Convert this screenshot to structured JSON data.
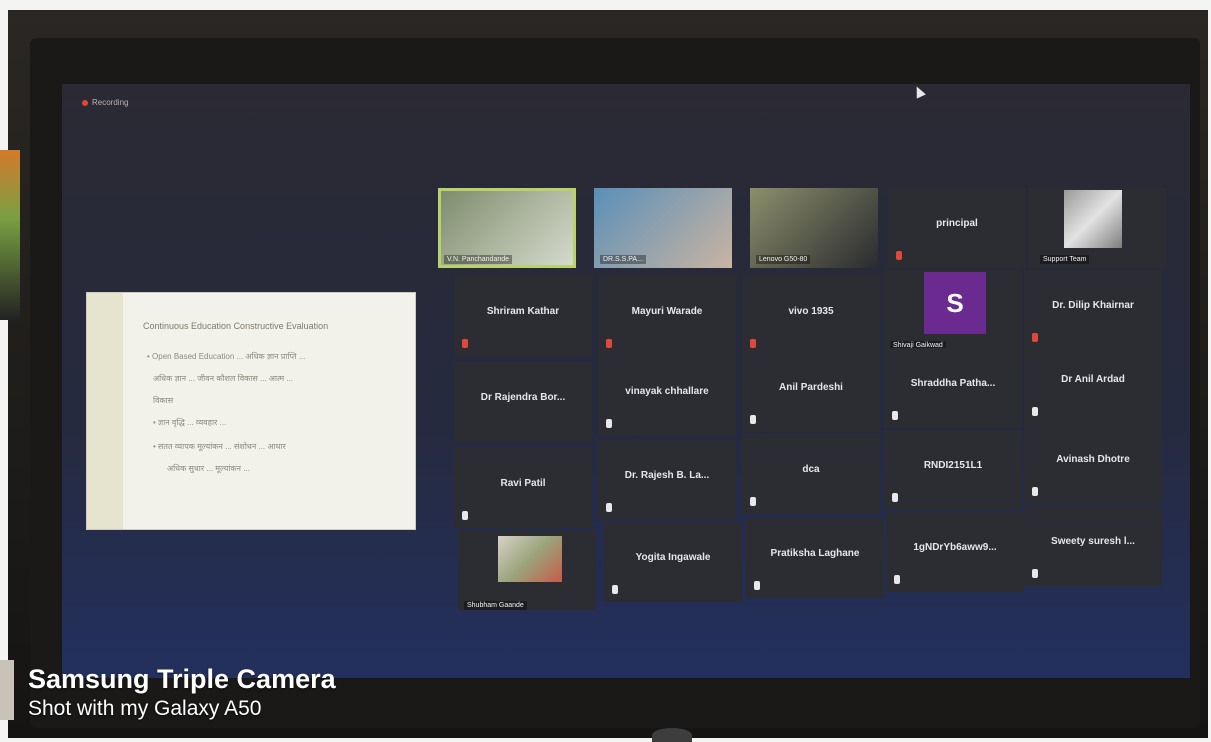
{
  "recording": {
    "label": "Recording"
  },
  "shared_screen": {
    "title": "Continuous Education Constructive Evaluation",
    "lines": [
      "• Open Based Education ... अधिक ज्ञान प्राप्ति ...",
      "अधिक ज्ञान ... जीवन कौशल विकास ... आत्म ...",
      "विकास",
      "• ज्ञान वृद्धि ... व्यवहार ...",
      "• सतत व्यापक मूल्यांकन ... संशोधन ... आधार",
      "अधिक सुधार ... मूल्यांकन ..."
    ]
  },
  "participants": [
    {
      "name": "V.N. Panchandande",
      "type": "video",
      "active": true
    },
    {
      "name": "DR.S.S.PA...",
      "type": "video"
    },
    {
      "name": "Lenovo G50-80",
      "type": "video"
    },
    {
      "name": "principal",
      "type": "text"
    },
    {
      "name": "Support Team",
      "type": "image"
    },
    {
      "name": "Shriram Kathar",
      "type": "text"
    },
    {
      "name": "Mayuri Warade",
      "type": "text"
    },
    {
      "name": "vivo 1935",
      "type": "text"
    },
    {
      "name": "Shivaji Gaikwad",
      "type": "avatar",
      "initial": "S"
    },
    {
      "name": "Dr. Dilip Khairnar",
      "type": "text"
    },
    {
      "name": "Dr Rajendra Bor...",
      "type": "text"
    },
    {
      "name": "vinayak chhallare",
      "type": "text"
    },
    {
      "name": "Anil Pardeshi",
      "type": "text"
    },
    {
      "name": "Shraddha Patha...",
      "type": "text"
    },
    {
      "name": "Dr Anil Ardad",
      "type": "text"
    },
    {
      "name": "Ravi Patil",
      "type": "text"
    },
    {
      "name": "Dr. Rajesh B. La...",
      "type": "text"
    },
    {
      "name": "dca",
      "type": "text"
    },
    {
      "name": "RNDI2151L1",
      "type": "text"
    },
    {
      "name": "Avinash Dhotre",
      "type": "text"
    },
    {
      "name": "Shubham Gaande",
      "type": "photo"
    },
    {
      "name": "Yogita Ingawale",
      "type": "text"
    },
    {
      "name": "Pratiksha Laghane",
      "type": "text"
    },
    {
      "name": "1gNDrYb6aww9...",
      "type": "text"
    },
    {
      "name": "Sweety suresh l...",
      "type": "text"
    }
  ],
  "watermark": {
    "line1": "Samsung Triple Camera",
    "line2": "Shot with my Galaxy A50"
  }
}
